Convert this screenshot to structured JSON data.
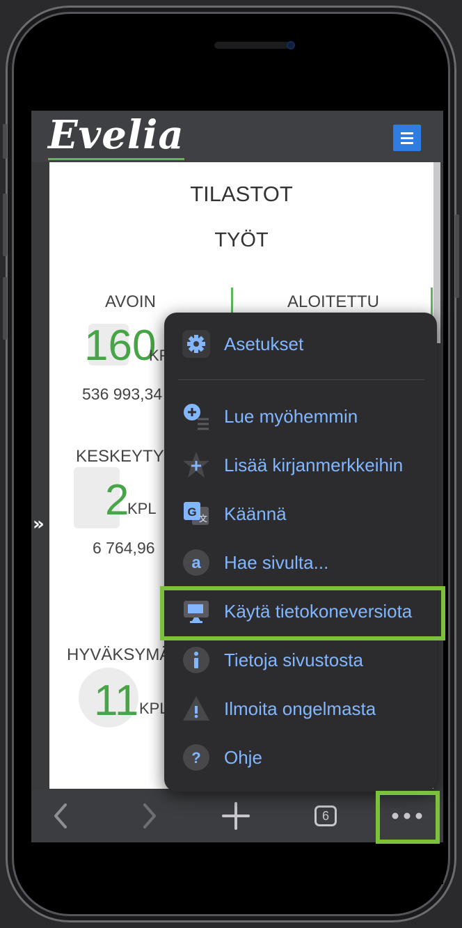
{
  "site": {
    "logo": "Evelia"
  },
  "page": {
    "title": "TILASTOT",
    "subtitle": "TYÖT"
  },
  "stats": {
    "avoin": {
      "label": "AVOIN",
      "count": "160",
      "unit": "KP",
      "amount": "536 993,34"
    },
    "aloitettu": {
      "label": "ALOITETTU"
    },
    "keskeytyneet": {
      "label": "KESKEYTYN",
      "count": "2",
      "unit": "KPL",
      "amount": "6 764,96"
    },
    "hyvaksymatta": {
      "label": "HYVÄKSYMÄ",
      "count": "11",
      "unit": "KPL"
    }
  },
  "side_toggle": "»",
  "menu": {
    "items": [
      {
        "label": "Asetukset",
        "icon": "gear-icon"
      },
      {
        "label": "Lue myöhemmin",
        "icon": "reading-list-icon"
      },
      {
        "label": "Lisää kirjanmerkkeihin",
        "icon": "bookmark-star-icon"
      },
      {
        "label": "Käännä",
        "icon": "translate-icon"
      },
      {
        "label": "Hae sivulta...",
        "icon": "find-in-page-icon"
      },
      {
        "label": "Käytä tietokoneversiota",
        "icon": "desktop-site-icon"
      },
      {
        "label": "Tietoja sivustosta",
        "icon": "info-icon"
      },
      {
        "label": "Ilmoita ongelmasta",
        "icon": "warning-icon"
      },
      {
        "label": "Ohje",
        "icon": "help-icon"
      }
    ]
  },
  "toolbar": {
    "back": "‹",
    "forward": "›",
    "new_tab": "+",
    "tab_count": "6",
    "more": "•••"
  },
  "colors": {
    "accent_green": "#5cb85c",
    "menu_text": "#82b6ff",
    "highlight": "#7cc13a",
    "hamburger": "#2f7de1"
  }
}
